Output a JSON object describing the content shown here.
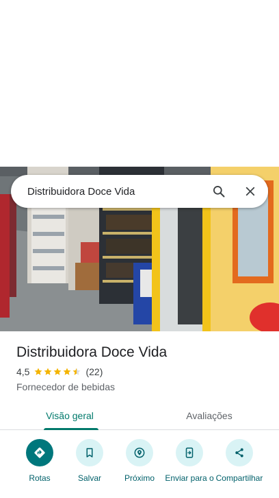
{
  "search": {
    "query": "Distribuidora Doce Vida"
  },
  "place": {
    "title": "Distribuidora Doce Vida",
    "rating": "4,5",
    "stars": 4.5,
    "review_count": "(22)",
    "category": "Fornecedor de bebidas"
  },
  "tabs": [
    {
      "label": "Visão geral",
      "active": true
    },
    {
      "label": "Avaliações",
      "active": false
    }
  ],
  "actions": [
    {
      "label": "Rotas",
      "icon": "directions-icon"
    },
    {
      "label": "Salvar",
      "icon": "bookmark-icon"
    },
    {
      "label": "Próximo",
      "icon": "nearby-icon"
    },
    {
      "label": "Enviar para o",
      "icon": "send-to-phone-icon"
    },
    {
      "label": "Compartilhar",
      "icon": "share-icon"
    }
  ],
  "colors": {
    "accent": "#00796b",
    "action_bg": "#d9f3f5",
    "primary_action": "#00777c",
    "star": "#f4b400"
  }
}
